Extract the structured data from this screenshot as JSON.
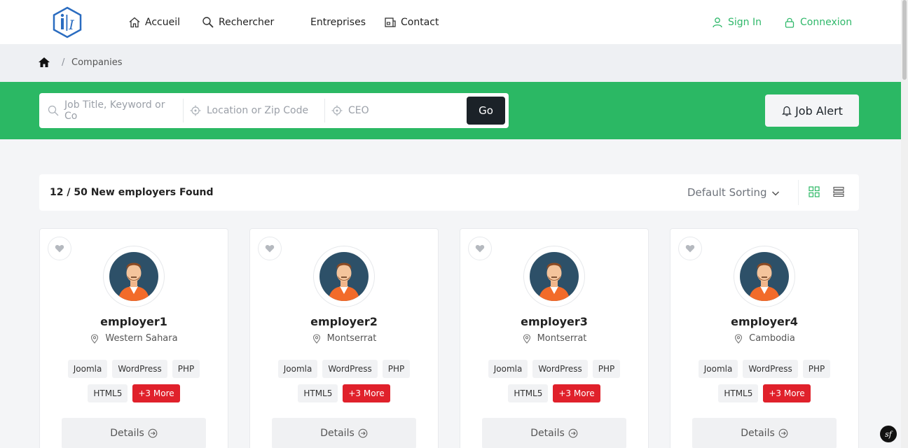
{
  "header": {
    "logo_text": "i|I",
    "nav": [
      {
        "label": "Accueil",
        "icon": "home-icon"
      },
      {
        "label": "Rechercher",
        "icon": "search-icon"
      },
      {
        "label": "Entreprises",
        "icon": ""
      },
      {
        "label": "Contact",
        "icon": "contact-card-icon"
      }
    ],
    "sign_in": "Sign In",
    "login": "Connexion"
  },
  "breadcrumb": {
    "separator": "/",
    "current": "Companies"
  },
  "search": {
    "keyword_placeholder": "Job Title, Keyword or Co",
    "location_placeholder": "Location or Zip Code",
    "third_placeholder": "CEO",
    "go_label": "Go",
    "job_alert_label": "Job Alert"
  },
  "results": {
    "count_text": "12 / 50 New employers Found",
    "sort_label": "Default Sorting"
  },
  "companies": [
    {
      "name": "employer1",
      "location": "Western Sahara",
      "tags": [
        "Joomla",
        "WordPress",
        "PHP",
        "HTML5"
      ],
      "more": "+3 More",
      "details": "Details"
    },
    {
      "name": "employer2",
      "location": "Montserrat",
      "tags": [
        "Joomla",
        "WordPress",
        "PHP",
        "HTML5"
      ],
      "more": "+3 More",
      "details": "Details"
    },
    {
      "name": "employer3",
      "location": "Montserrat",
      "tags": [
        "Joomla",
        "WordPress",
        "PHP",
        "HTML5"
      ],
      "more": "+3 More",
      "details": "Details"
    },
    {
      "name": "employer4",
      "location": "Cambodia",
      "tags": [
        "Joomla",
        "WordPress",
        "PHP",
        "HTML5"
      ],
      "more": "+3 More",
      "details": "Details"
    }
  ],
  "colors": {
    "accent": "#2bb864",
    "dark": "#1b2228",
    "more_tag": "#e0212b"
  },
  "debug_badge": "sf"
}
